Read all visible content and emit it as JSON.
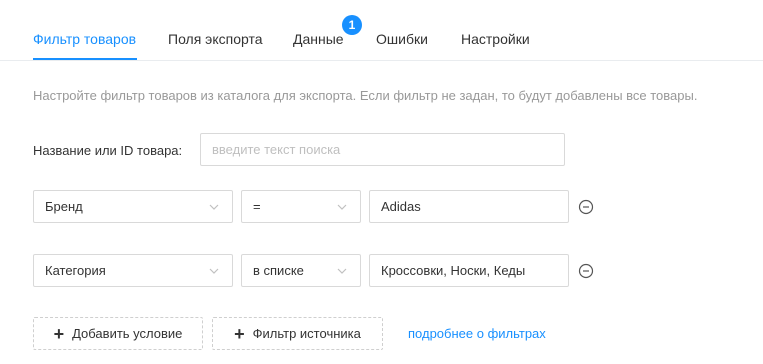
{
  "tabs": [
    {
      "label": "Фильтр товаров",
      "active": true
    },
    {
      "label": "Поля экспорта",
      "active": false
    },
    {
      "label": "Данные",
      "active": false,
      "badge": "1"
    },
    {
      "label": "Ошибки",
      "active": false
    },
    {
      "label": "Настройки",
      "active": false
    }
  ],
  "hint": "Настройте фильтр товаров из каталога для экспорта. Если фильтр не задан, то будут добавлены все товары.",
  "search": {
    "label": "Название или ID товара:",
    "placeholder": "введите текст поиска"
  },
  "conditions": [
    {
      "field": "Бренд",
      "operator": "=",
      "value": "Adidas"
    },
    {
      "field": "Категория",
      "operator": "в списке",
      "value": "Кроссовки, Носки, Кеды"
    }
  ],
  "actions": {
    "add_condition": "Добавить условие",
    "source_filter": "Фильтр источника",
    "more_link": "подробнее о фильтрах"
  },
  "colors": {
    "accent": "#1890ff",
    "border": "#d9d9d9",
    "hint_text": "#999999"
  },
  "icons": {
    "chevron": "chevron-down-icon",
    "remove": "minus-circle-icon",
    "plus": "plus-icon"
  }
}
